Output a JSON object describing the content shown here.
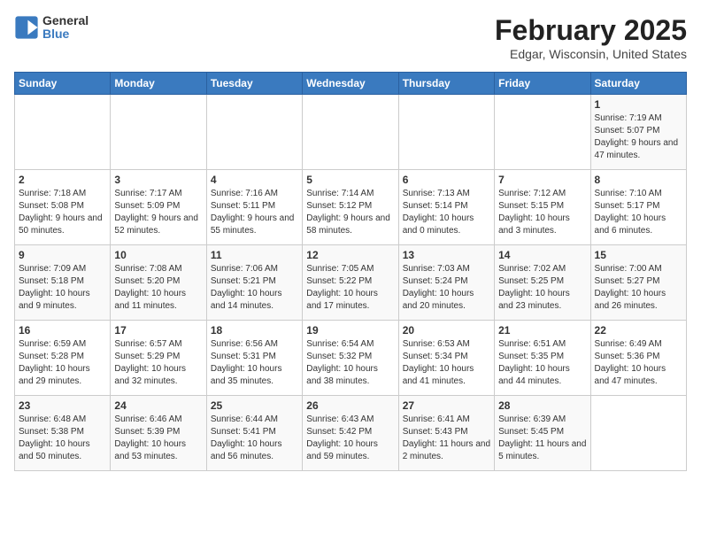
{
  "header": {
    "logo_general": "General",
    "logo_blue": "Blue",
    "month_title": "February 2025",
    "location": "Edgar, Wisconsin, United States"
  },
  "days_of_week": [
    "Sunday",
    "Monday",
    "Tuesday",
    "Wednesday",
    "Thursday",
    "Friday",
    "Saturday"
  ],
  "weeks": [
    [
      {
        "day": "",
        "info": ""
      },
      {
        "day": "",
        "info": ""
      },
      {
        "day": "",
        "info": ""
      },
      {
        "day": "",
        "info": ""
      },
      {
        "day": "",
        "info": ""
      },
      {
        "day": "",
        "info": ""
      },
      {
        "day": "1",
        "info": "Sunrise: 7:19 AM\nSunset: 5:07 PM\nDaylight: 9 hours and 47 minutes."
      }
    ],
    [
      {
        "day": "2",
        "info": "Sunrise: 7:18 AM\nSunset: 5:08 PM\nDaylight: 9 hours and 50 minutes."
      },
      {
        "day": "3",
        "info": "Sunrise: 7:17 AM\nSunset: 5:09 PM\nDaylight: 9 hours and 52 minutes."
      },
      {
        "day": "4",
        "info": "Sunrise: 7:16 AM\nSunset: 5:11 PM\nDaylight: 9 hours and 55 minutes."
      },
      {
        "day": "5",
        "info": "Sunrise: 7:14 AM\nSunset: 5:12 PM\nDaylight: 9 hours and 58 minutes."
      },
      {
        "day": "6",
        "info": "Sunrise: 7:13 AM\nSunset: 5:14 PM\nDaylight: 10 hours and 0 minutes."
      },
      {
        "day": "7",
        "info": "Sunrise: 7:12 AM\nSunset: 5:15 PM\nDaylight: 10 hours and 3 minutes."
      },
      {
        "day": "8",
        "info": "Sunrise: 7:10 AM\nSunset: 5:17 PM\nDaylight: 10 hours and 6 minutes."
      }
    ],
    [
      {
        "day": "9",
        "info": "Sunrise: 7:09 AM\nSunset: 5:18 PM\nDaylight: 10 hours and 9 minutes."
      },
      {
        "day": "10",
        "info": "Sunrise: 7:08 AM\nSunset: 5:20 PM\nDaylight: 10 hours and 11 minutes."
      },
      {
        "day": "11",
        "info": "Sunrise: 7:06 AM\nSunset: 5:21 PM\nDaylight: 10 hours and 14 minutes."
      },
      {
        "day": "12",
        "info": "Sunrise: 7:05 AM\nSunset: 5:22 PM\nDaylight: 10 hours and 17 minutes."
      },
      {
        "day": "13",
        "info": "Sunrise: 7:03 AM\nSunset: 5:24 PM\nDaylight: 10 hours and 20 minutes."
      },
      {
        "day": "14",
        "info": "Sunrise: 7:02 AM\nSunset: 5:25 PM\nDaylight: 10 hours and 23 minutes."
      },
      {
        "day": "15",
        "info": "Sunrise: 7:00 AM\nSunset: 5:27 PM\nDaylight: 10 hours and 26 minutes."
      }
    ],
    [
      {
        "day": "16",
        "info": "Sunrise: 6:59 AM\nSunset: 5:28 PM\nDaylight: 10 hours and 29 minutes."
      },
      {
        "day": "17",
        "info": "Sunrise: 6:57 AM\nSunset: 5:29 PM\nDaylight: 10 hours and 32 minutes."
      },
      {
        "day": "18",
        "info": "Sunrise: 6:56 AM\nSunset: 5:31 PM\nDaylight: 10 hours and 35 minutes."
      },
      {
        "day": "19",
        "info": "Sunrise: 6:54 AM\nSunset: 5:32 PM\nDaylight: 10 hours and 38 minutes."
      },
      {
        "day": "20",
        "info": "Sunrise: 6:53 AM\nSunset: 5:34 PM\nDaylight: 10 hours and 41 minutes."
      },
      {
        "day": "21",
        "info": "Sunrise: 6:51 AM\nSunset: 5:35 PM\nDaylight: 10 hours and 44 minutes."
      },
      {
        "day": "22",
        "info": "Sunrise: 6:49 AM\nSunset: 5:36 PM\nDaylight: 10 hours and 47 minutes."
      }
    ],
    [
      {
        "day": "23",
        "info": "Sunrise: 6:48 AM\nSunset: 5:38 PM\nDaylight: 10 hours and 50 minutes."
      },
      {
        "day": "24",
        "info": "Sunrise: 6:46 AM\nSunset: 5:39 PM\nDaylight: 10 hours and 53 minutes."
      },
      {
        "day": "25",
        "info": "Sunrise: 6:44 AM\nSunset: 5:41 PM\nDaylight: 10 hours and 56 minutes."
      },
      {
        "day": "26",
        "info": "Sunrise: 6:43 AM\nSunset: 5:42 PM\nDaylight: 10 hours and 59 minutes."
      },
      {
        "day": "27",
        "info": "Sunrise: 6:41 AM\nSunset: 5:43 PM\nDaylight: 11 hours and 2 minutes."
      },
      {
        "day": "28",
        "info": "Sunrise: 6:39 AM\nSunset: 5:45 PM\nDaylight: 11 hours and 5 minutes."
      },
      {
        "day": "",
        "info": ""
      }
    ]
  ]
}
